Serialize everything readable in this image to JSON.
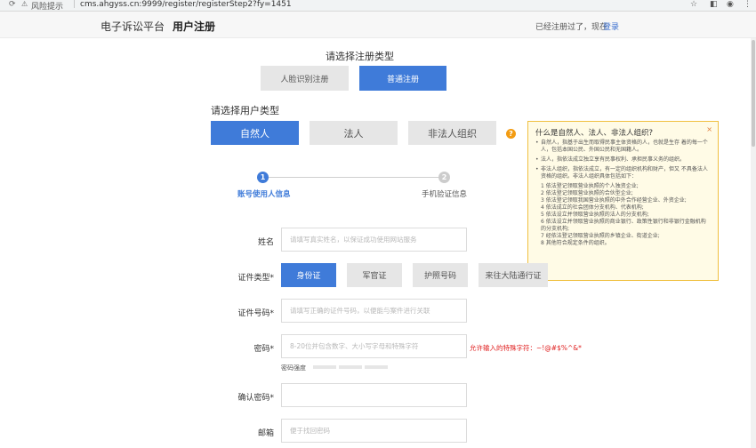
{
  "browser": {
    "warning_text": "风险提示",
    "url": "cms.ahgyss.cn:9999/register/registerStep2?fy=1451",
    "reload_icon": "reload-icon",
    "warning_icon": "warning-icon"
  },
  "header": {
    "brand": "电子诉讼平台",
    "page_title": "用户注册",
    "already_registered": "已经注册过了，现在",
    "login_link": "登录"
  },
  "registration_type": {
    "title": "请选择注册类型",
    "options": [
      "人脸识别注册",
      "普通注册"
    ],
    "selected": "普通注册"
  },
  "user_type": {
    "title": "请选择用户类型",
    "options": [
      "自然人",
      "法人",
      "非法人组织"
    ],
    "selected": "自然人"
  },
  "tooltip": {
    "title": "什么是自然人、法人、非法人组织?",
    "close": "×",
    "items": [
      "自然人，指基于出生而取得民事主体资格的人，也就是生存 着的每一个人，包括本国公民、外国公民和无国籍人。",
      "法人，指依法成立独立享有民事权利、承担民事义务的组织。",
      "非法人组织，指依法成立，有一定的组织机构和财产，但又 不具备法人资格的组织。非法人组织具体包括如下："
    ],
    "subitems": [
      "1 依法登记领取营业执照的个人独资企业;",
      "2 依法登记领取营业执照的合伙型企业;",
      "3 依法登记领取我国营业执照的中外合作经营企业、外资企业;",
      "4 依法成立的社会团体分支机构、代表机构;",
      "5 依法设立并领取营业执照的法人的分支机构;",
      "6 依法设立并领取营业执照的商业银行、政策性银行和非银行金融机构的分支机构;",
      "7 经依法登记领取营业执照的乡镇企业、街道企业;",
      "8 其他符合规定条件的组织。"
    ]
  },
  "steps": [
    {
      "number": "1",
      "label": "账号使用人信息",
      "active": true
    },
    {
      "number": "2",
      "label": "手机验证信息",
      "active": false
    }
  ],
  "form": {
    "name": {
      "label": "姓名",
      "placeholder": "请填写真实姓名，以保证成功使用网站服务"
    },
    "id_type": {
      "label": "证件类型*",
      "options": [
        "身份证",
        "军官证",
        "护照号码",
        "来往大陆通行证"
      ],
      "selected": "身份证"
    },
    "id_number": {
      "label": "证件号码*",
      "placeholder": "请填写正确的证件号码，以便能与案件进行关联"
    },
    "password": {
      "label": "密码*",
      "placeholder": "8-20位并包含数字、大小写字母和特殊字符",
      "hint": "允许输入的特殊字符：~!@#$%^&*",
      "strength_label": "密码强度"
    },
    "confirm_password": {
      "label": "确认密码*",
      "placeholder": ""
    },
    "email": {
      "label": "邮箱",
      "placeholder": "便于找回密码"
    }
  },
  "colors": {
    "primary": "#3f7bd9",
    "neutral_button": "#e6e6e6",
    "tooltip_bg": "#fffbe6",
    "tooltip_border": "#f0c040",
    "help_icon": "#f39c12",
    "error_text": "#e02020"
  }
}
